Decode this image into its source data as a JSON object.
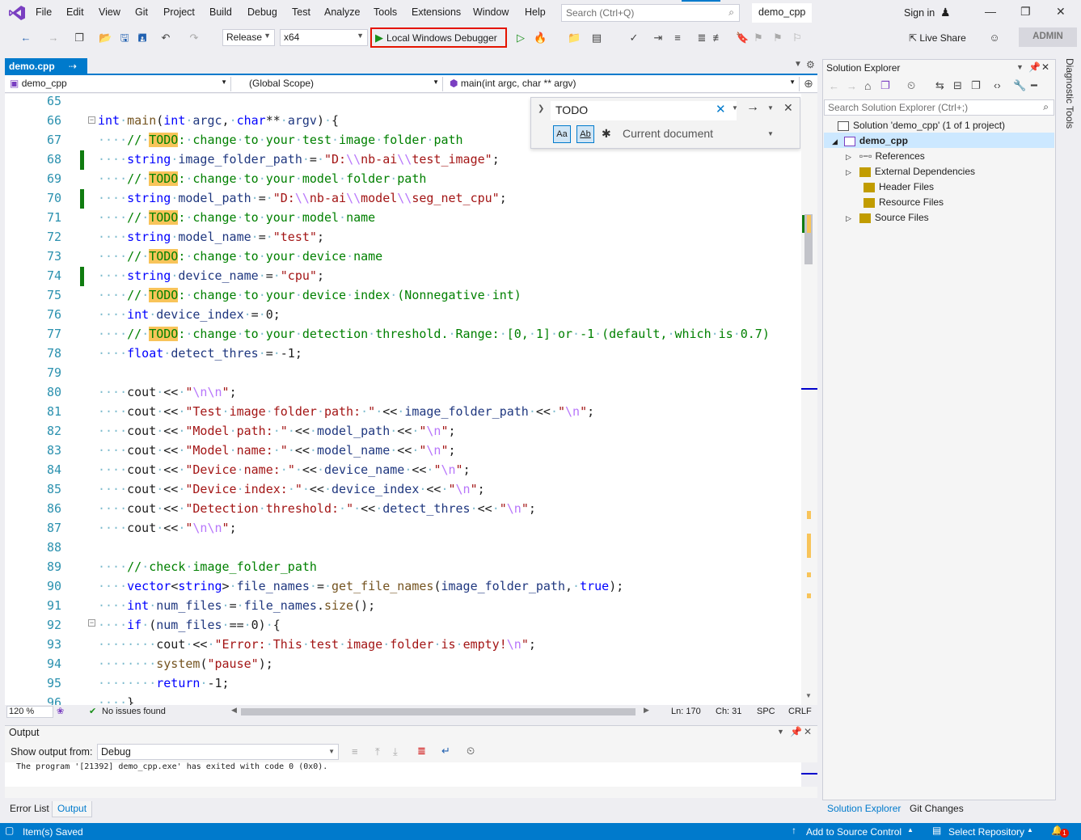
{
  "menu": [
    "File",
    "Edit",
    "View",
    "Git",
    "Project",
    "Build",
    "Debug",
    "Test",
    "Analyze",
    "Tools",
    "Extensions",
    "Window",
    "Help"
  ],
  "search": {
    "placeholder": "Search (Ctrl+Q)"
  },
  "window_title": "demo_cpp",
  "signin": "Sign in",
  "toolbar": {
    "config": "Release",
    "platform": "x64",
    "debugger_label": "Local Windows Debugger",
    "liveshare": "Live Share",
    "admin": "ADMIN"
  },
  "editor": {
    "tab_label": "demo.cpp",
    "nav_project": "demo_cpp",
    "nav_scope": "(Global Scope)",
    "nav_member": "main(int argc, char ** argv)",
    "line_numbers": [
      "65",
      "66",
      "67",
      "68",
      "69",
      "70",
      "71",
      "72",
      "73",
      "74",
      "75",
      "76",
      "77",
      "78",
      "79",
      "80",
      "81",
      "82",
      "83",
      "84",
      "85",
      "86",
      "87",
      "88",
      "89",
      "90",
      "91",
      "92",
      "93",
      "94",
      "95",
      "96"
    ]
  },
  "find": {
    "query": "TODO",
    "scope": "Current document",
    "match_case": "Aa",
    "whole_word": "Ab"
  },
  "editor_status": {
    "zoom": "120 %",
    "issues": "No issues found",
    "ln": "Ln: 170",
    "ch": "Ch: 31",
    "spc": "SPC",
    "crlf": "CRLF"
  },
  "output": {
    "title": "Output",
    "show_from_label": "Show output from:",
    "source": "Debug",
    "text": "The program '[21392] demo_cpp.exe' has exited with code 0 (0x0)."
  },
  "bottom_tabs": [
    "Error List",
    "Output"
  ],
  "solution_explorer": {
    "title": "Solution Explorer",
    "search_placeholder": "Search Solution Explorer (Ctrl+;)",
    "solution": "Solution 'demo_cpp' (1 of 1 project)",
    "project": "demo_cpp",
    "items": [
      "References",
      "External Dependencies",
      "Header Files",
      "Resource Files",
      "Source Files"
    ],
    "tabs": [
      "Solution Explorer",
      "Git Changes"
    ],
    "side_label": "Diagnostic Tools"
  },
  "statusbar": {
    "left": "Item(s) Saved",
    "source_control": "Add to Source Control",
    "repo": "Select Repository",
    "notifications": "1"
  },
  "colors": {
    "accent": "#007acc",
    "todo_highlight": "#f8c45a",
    "debugger_outline": "#e51400",
    "changebar": "#107c10"
  }
}
